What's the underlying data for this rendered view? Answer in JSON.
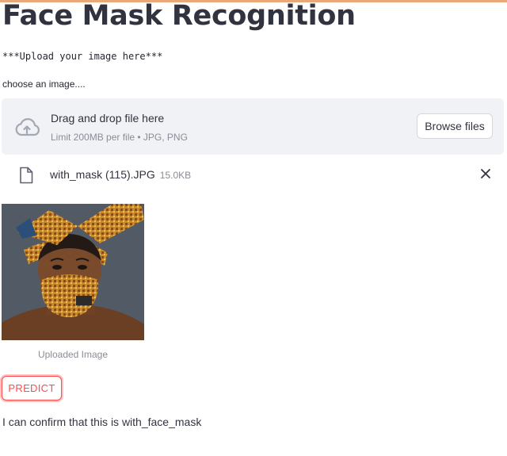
{
  "header": {
    "title": "Face Mask Recognition"
  },
  "upload": {
    "note": "***Upload your image here***",
    "label": "choose an image....",
    "dropzone_text": "Drag and drop file here",
    "limit_text": "Limit 200MB per file • JPG, PNG",
    "browse_label": "Browse files"
  },
  "file": {
    "name": "with_mask (115).JPG",
    "size": "15.0KB"
  },
  "image": {
    "caption": "Uploaded Image"
  },
  "actions": {
    "predict_label": "PREDICT"
  },
  "result": {
    "text": "I can confirm that this is with_face_mask"
  },
  "icons": {
    "upload": "cloud-upload-icon",
    "file": "file-icon",
    "close": "close-icon"
  },
  "colors": {
    "accent": "#ff4b4b",
    "dropzone_bg": "#f0f2f6",
    "text": "#31333f",
    "muted": "#8a8d97"
  }
}
